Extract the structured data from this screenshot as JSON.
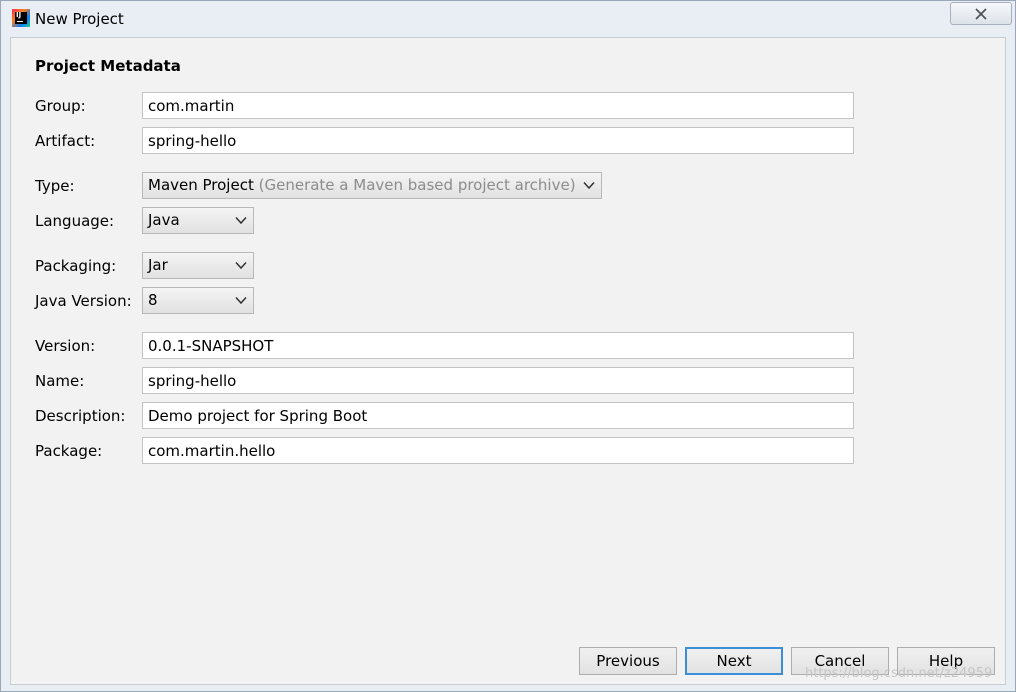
{
  "window": {
    "title": "New Project",
    "icons": {
      "app": "intellij-idea-icon",
      "close": "close-icon"
    }
  },
  "form": {
    "section_title": "Project Metadata",
    "group": {
      "label": "Group:",
      "value": "com.martin"
    },
    "artifact": {
      "label": "Artifact:",
      "value": "spring-hello"
    },
    "type": {
      "label": "Type:",
      "selected": "Maven Project",
      "hint": "(Generate a Maven based project archive)"
    },
    "language": {
      "label": "Language:",
      "selected": "Java"
    },
    "packaging": {
      "label": "Packaging:",
      "selected": "Jar"
    },
    "java_version": {
      "label": "Java Version:",
      "selected": "8"
    },
    "version": {
      "label": "Version:",
      "value": "0.0.1-SNAPSHOT"
    },
    "name": {
      "label": "Name:",
      "value": "spring-hello"
    },
    "description": {
      "label": "Description:",
      "value": "Demo project for Spring Boot"
    },
    "package": {
      "label": "Package:",
      "value": "com.martin.hello"
    }
  },
  "buttons": {
    "previous": "Previous",
    "next": "Next",
    "cancel": "Cancel",
    "help": "Help"
  },
  "colors": {
    "default_button_border": "#3b8fd9",
    "dialog_background": "#f2f2f2",
    "title_bar": "#e9eef5"
  },
  "watermark": "https://blog.csdn.net/z24959"
}
